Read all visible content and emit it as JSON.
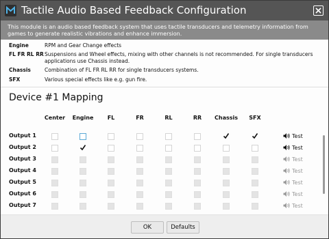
{
  "window": {
    "title": "Tactile Audio Based Feedback Configuration"
  },
  "banner": {
    "text": "This module is an audio based feedback system that uses tactile transducers and telemetry information from games to generate realistic vibrations and enhance immersion."
  },
  "definitions": [
    {
      "term": "Engine",
      "desc": "RPM and Gear Change effects"
    },
    {
      "term": "FL FR RL RR",
      "desc": "Suspensions and Wheel effects, mixing with other channels is not recommended. For single transducers applications use Chassis instead."
    },
    {
      "term": "Chassis",
      "desc": "Combination of FL FR RL RR for single transducers systems."
    },
    {
      "term": "SFX",
      "desc": "Various special effects like e.g. gun fire."
    }
  ],
  "mapping": {
    "title": "Device #1 Mapping",
    "columns": [
      "Center",
      "Engine",
      "FL",
      "FR",
      "RL",
      "RR",
      "Chassis",
      "SFX"
    ],
    "rows": [
      {
        "label": "Output 1",
        "checked": [
          false,
          false,
          false,
          false,
          false,
          false,
          true,
          true
        ],
        "enabled": true,
        "test_label": "Test"
      },
      {
        "label": "Output 2",
        "checked": [
          false,
          true,
          false,
          false,
          false,
          false,
          false,
          false
        ],
        "enabled": true,
        "test_label": "Test"
      },
      {
        "label": "Output 3",
        "checked": [
          false,
          false,
          false,
          false,
          false,
          false,
          false,
          false
        ],
        "enabled": false,
        "test_label": "Test"
      },
      {
        "label": "Output 4",
        "checked": [
          false,
          false,
          false,
          false,
          false,
          false,
          false,
          false
        ],
        "enabled": false,
        "test_label": "Test"
      },
      {
        "label": "Output 5",
        "checked": [
          false,
          false,
          false,
          false,
          false,
          false,
          false,
          false
        ],
        "enabled": false,
        "test_label": "Test"
      },
      {
        "label": "Output 6",
        "checked": [
          false,
          false,
          false,
          false,
          false,
          false,
          false,
          false
        ],
        "enabled": false,
        "test_label": "Test"
      },
      {
        "label": "Output 7",
        "checked": [
          false,
          false,
          false,
          false,
          false,
          false,
          false,
          false
        ],
        "enabled": false,
        "test_label": "Test"
      }
    ]
  },
  "footer": {
    "ok_label": "OK",
    "defaults_label": "Defaults"
  },
  "colors": {
    "titlebar": "#555555",
    "banner": "#8a8a8a",
    "focus": "#5aa9d6"
  }
}
